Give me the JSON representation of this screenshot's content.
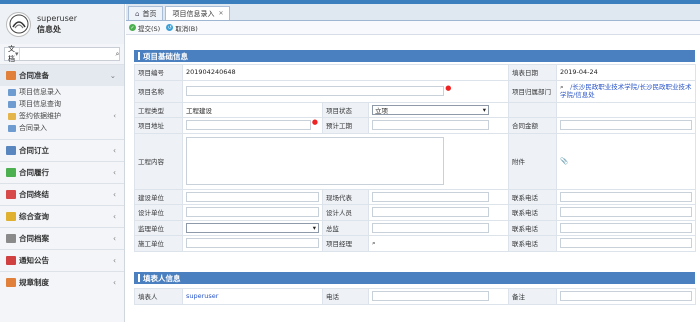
{
  "user": {
    "name": "superuser",
    "org": "信息处"
  },
  "search": {
    "scope": "文档",
    "placeholder": ""
  },
  "sidebar": {
    "groups": [
      {
        "label": "合同准备",
        "color": "#e0803a",
        "open": true
      },
      {
        "label": "合同订立",
        "color": "#5a86c0"
      },
      {
        "label": "合同履行",
        "color": "#4caf50"
      },
      {
        "label": "合同终结",
        "color": "#d84a4a"
      },
      {
        "label": "综合查询",
        "color": "#e0b030"
      },
      {
        "label": "合同档案",
        "color": "#8a8a8a"
      },
      {
        "label": "通知公告",
        "color": "#d04040"
      },
      {
        "label": "规章制度",
        "color": "#e0803a"
      }
    ],
    "sub_items": [
      {
        "label": "项目信息录入",
        "type": "doc"
      },
      {
        "label": "项目信息查询",
        "type": "doc"
      },
      {
        "label": "签约依据维护",
        "type": "folder"
      },
      {
        "label": "合同录入",
        "type": "doc"
      }
    ]
  },
  "tabs": [
    {
      "label": "首页"
    },
    {
      "label": "项目信息录入"
    }
  ],
  "toolbar": {
    "submit_label": "提交(S)",
    "cancel_label": "取消(B)"
  },
  "section1": {
    "title": "项目基础信息",
    "labels": {
      "project_no": "项目编号",
      "fill_date": "填表日期",
      "project_name": "项目名称",
      "dept": "项目归属部门",
      "project_type": "工程类型",
      "project_status": "项目状态",
      "address": "项目地址",
      "est_duration": "预计工期",
      "contract_amount": "合同金额",
      "content": "工程内容",
      "attachment": "附件",
      "build_unit": "建设单位",
      "site_rep": "现场代表",
      "phone": "联系电话",
      "design_unit": "设计单位",
      "designer": "设计人员",
      "supervise_unit": "监理单位",
      "chief_supervisor": "总监",
      "construct_unit": "施工单位",
      "project_manager": "项目经理"
    },
    "values": {
      "project_no": "201904240648",
      "fill_date": "2019-04-24",
      "project_type": "工程建设",
      "project_status": "立项",
      "dept": "/长沙民政职业技术学院/长沙民政职业技术学院/信息处"
    }
  },
  "section2": {
    "title": "填表人信息",
    "labels": {
      "filler": "填表人",
      "phone": "电话",
      "remark": "备注"
    },
    "values": {
      "filler": "superuser"
    }
  }
}
